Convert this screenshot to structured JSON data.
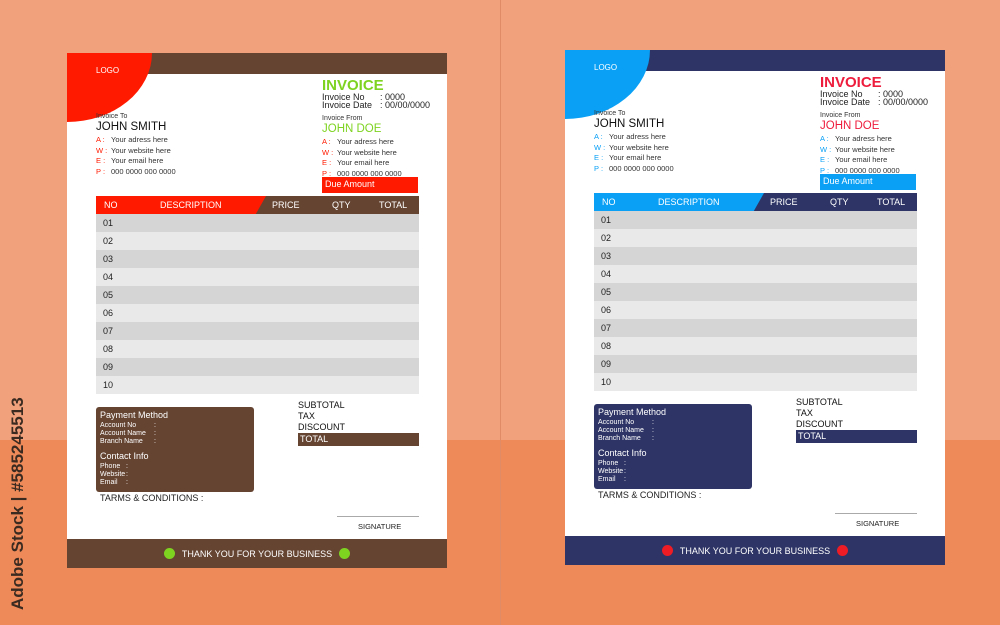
{
  "watermark": "Adobe Stock | #585245513",
  "invoices": [
    {
      "colors": {
        "primary": "#ff1a00",
        "secondary": "#654432",
        "title": "#7ed321",
        "label": "#ff1a00",
        "dot": "#7ed321"
      },
      "logo": "LOGO",
      "title": "INVOICE",
      "invoice_no_label": "Invoice No",
      "invoice_no": ": 0000",
      "invoice_date_label": "Invoice Date",
      "invoice_date": ": 00/00/0000",
      "to": {
        "label": "Invoice To",
        "name": "JOHN SMITH",
        "rows": [
          {
            "k": "A :",
            "v": "Your adress here"
          },
          {
            "k": "W :",
            "v": "Your website here"
          },
          {
            "k": "E :",
            "v": "Your email here"
          },
          {
            "k": "P :",
            "v": "000 0000 000 0000"
          }
        ]
      },
      "from": {
        "label": "Invoice From",
        "name": "JOHN DOE",
        "rows": [
          {
            "k": "A :",
            "v": "Your adress here"
          },
          {
            "k": "W :",
            "v": "Your website here"
          },
          {
            "k": "E :",
            "v": "Your email here"
          },
          {
            "k": "P :",
            "v": "000 0000 000 0000"
          }
        ]
      },
      "due_amount": "Due Amount",
      "columns": [
        "NO",
        "DESCRIPTION",
        "PRICE",
        "QTY",
        "TOTAL"
      ],
      "rows": [
        "01",
        "02",
        "03",
        "04",
        "05",
        "06",
        "07",
        "08",
        "09",
        "10"
      ],
      "payment": {
        "title": "Payment Method",
        "lines": [
          "Account No",
          "Account Name",
          "Branch Name"
        ]
      },
      "contact": {
        "title": "Contact Info",
        "lines": [
          "Phone",
          "Website",
          "Email"
        ]
      },
      "summary": [
        "SUBTOTAL",
        "TAX",
        "DISCOUNT"
      ],
      "total": "TOTAL",
      "terms": "TARMS & CONDITIONS :",
      "signature": "SIGNATURE",
      "footer": "THANK YOU FOR YOUR BUSINESS"
    },
    {
      "colors": {
        "primary": "#0aa0f5",
        "secondary": "#2e3566",
        "title": "#ee1c3c",
        "label": "#0aa0f5",
        "dot": "#ee1c24"
      },
      "logo": "LOGO",
      "title": "INVOICE",
      "invoice_no_label": "Invoice No",
      "invoice_no": ": 0000",
      "invoice_date_label": "Invoice Date",
      "invoice_date": ": 00/00/0000",
      "to": {
        "label": "Invoice To",
        "name": "JOHN SMITH",
        "rows": [
          {
            "k": "A :",
            "v": "Your adress here"
          },
          {
            "k": "W :",
            "v": "Your website here"
          },
          {
            "k": "E :",
            "v": "Your email here"
          },
          {
            "k": "P :",
            "v": "000 0000 000 0000"
          }
        ]
      },
      "from": {
        "label": "Invoice From",
        "name": "JOHN DOE",
        "rows": [
          {
            "k": "A :",
            "v": "Your adress here"
          },
          {
            "k": "W :",
            "v": "Your website here"
          },
          {
            "k": "E :",
            "v": "Your email here"
          },
          {
            "k": "P :",
            "v": "000 0000 000 0000"
          }
        ]
      },
      "due_amount": "Due Amount",
      "columns": [
        "NO",
        "DESCRIPTION",
        "PRICE",
        "QTY",
        "TOTAL"
      ],
      "rows": [
        "01",
        "02",
        "03",
        "04",
        "05",
        "06",
        "07",
        "08",
        "09",
        "10"
      ],
      "payment": {
        "title": "Payment Method",
        "lines": [
          "Account No",
          "Account Name",
          "Branch Name"
        ]
      },
      "contact": {
        "title": "Contact Info",
        "lines": [
          "Phone",
          "Website",
          "Email"
        ]
      },
      "summary": [
        "SUBTOTAL",
        "TAX",
        "DISCOUNT"
      ],
      "total": "TOTAL",
      "terms": "TARMS & CONDITIONS :",
      "signature": "SIGNATURE",
      "footer": "THANK YOU FOR YOUR BUSINESS"
    }
  ]
}
